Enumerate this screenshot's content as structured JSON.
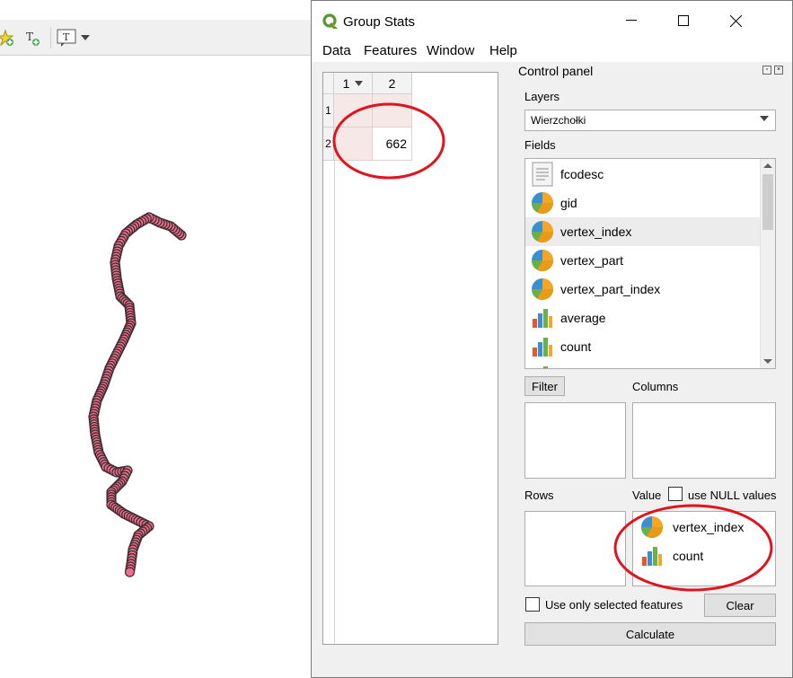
{
  "window": {
    "title": "Group Stats",
    "menu": [
      "Data",
      "Features",
      "Window",
      "Help"
    ]
  },
  "table": {
    "col_headers": [
      "1",
      "2"
    ],
    "row_headers": [
      "1",
      "2"
    ],
    "cells": [
      [
        "",
        ""
      ],
      [
        "",
        "662"
      ]
    ]
  },
  "control_panel": {
    "title": "Control panel",
    "layers_label": "Layers",
    "layer_selected": "Wierzchołki",
    "fields_label": "Fields",
    "fields": [
      {
        "name": "fcodesc",
        "icon": "text-field-icon"
      },
      {
        "name": "gid",
        "icon": "pie-field-icon"
      },
      {
        "name": "vertex_index",
        "icon": "pie-field-icon"
      },
      {
        "name": "vertex_part",
        "icon": "pie-field-icon"
      },
      {
        "name": "vertex_part_index",
        "icon": "pie-field-icon"
      },
      {
        "name": "average",
        "icon": "bar-field-icon"
      },
      {
        "name": "count",
        "icon": "bar-field-icon"
      }
    ],
    "filter_button": "Filter",
    "columns_label": "Columns",
    "rows_label": "Rows",
    "value_label": "Value",
    "use_null_label": "use NULL values",
    "value_items": [
      {
        "name": "vertex_index",
        "icon": "pie-field-icon"
      },
      {
        "name": "count",
        "icon": "bar-field-icon"
      }
    ],
    "selected_only_label": "Use only selected features",
    "clear_button": "Clear",
    "calculate_button": "Calculate"
  },
  "colors": {
    "annotation": "#e0141e",
    "map_point_fill": "#ef6f8c",
    "map_point_stroke": "#3a2a2e",
    "qgis_green": "#589632"
  }
}
